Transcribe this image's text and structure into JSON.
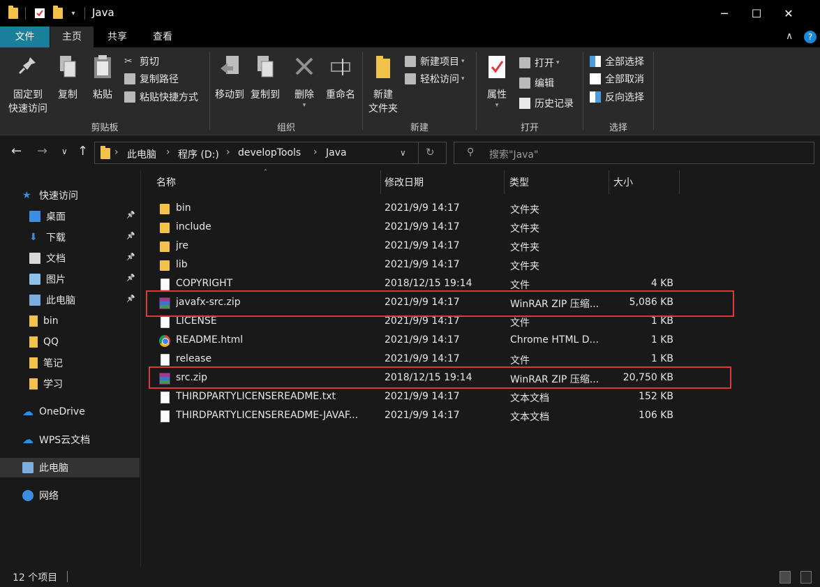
{
  "window": {
    "title": "Java",
    "controls": [
      "─",
      "☐",
      "✕"
    ]
  },
  "tabs": [
    "文件",
    "主页",
    "共享",
    "查看"
  ],
  "ribbon": {
    "clipboard": {
      "pin": "固定到\n快速访问",
      "pin_l1": "固定到",
      "pin_l2": "快速访问",
      "copy": "复制",
      "paste": "粘贴",
      "cut": "剪切",
      "copy_path": "复制路径",
      "paste_shortcut": "粘贴快捷方式",
      "label": "剪贴板"
    },
    "organize": {
      "move_to": "移动到",
      "copy_to": "复制到",
      "delete": "删除",
      "rename": "重命名",
      "label": "组织"
    },
    "new": {
      "new_folder_l1": "新建",
      "new_folder_l2": "文件夹",
      "new_item": "新建项目",
      "easy_access": "轻松访问",
      "label": "新建"
    },
    "open": {
      "properties": "属性",
      "open": "打开",
      "edit": "编辑",
      "history": "历史记录",
      "label": "打开"
    },
    "select": {
      "select_all": "全部选择",
      "select_none": "全部取消",
      "invert": "反向选择",
      "label": "选择"
    }
  },
  "address": {
    "crumbs": [
      "此电脑",
      "程序 (D:)",
      "developTools",
      "Java"
    ],
    "search_placeholder": "搜索\"Java\""
  },
  "sidebar": {
    "items": [
      {
        "label": "快速访问",
        "icon": "star-icon"
      },
      {
        "label": "桌面",
        "icon": "desktop-icon",
        "pinned": true
      },
      {
        "label": "下载",
        "icon": "download-icon",
        "pinned": true
      },
      {
        "label": "文档",
        "icon": "document-icon",
        "pinned": true
      },
      {
        "label": "图片",
        "icon": "picture-icon",
        "pinned": true
      },
      {
        "label": "此电脑",
        "icon": "computer-icon",
        "pinned": true
      },
      {
        "label": "bin",
        "icon": "folder-icon"
      },
      {
        "label": "QQ",
        "icon": "folder-icon"
      },
      {
        "label": "笔记",
        "icon": "folder-icon"
      },
      {
        "label": "学习",
        "icon": "folder-icon"
      },
      {
        "label": "OneDrive",
        "icon": "cloud-icon"
      },
      {
        "label": "WPS云文档",
        "icon": "cloud-outline-icon"
      },
      {
        "label": "此电脑",
        "icon": "computer-icon"
      },
      {
        "label": "网络",
        "icon": "network-icon"
      }
    ]
  },
  "columns": {
    "name": "名称",
    "date": "修改日期",
    "type": "类型",
    "size": "大小"
  },
  "files": [
    {
      "name": "bin",
      "date": "2021/9/9 14:17",
      "type": "文件夹",
      "size": "",
      "icon": "folder"
    },
    {
      "name": "include",
      "date": "2021/9/9 14:17",
      "type": "文件夹",
      "size": "",
      "icon": "folder"
    },
    {
      "name": "jre",
      "date": "2021/9/9 14:17",
      "type": "文件夹",
      "size": "",
      "icon": "folder"
    },
    {
      "name": "lib",
      "date": "2021/9/9 14:17",
      "type": "文件夹",
      "size": "",
      "icon": "folder"
    },
    {
      "name": "COPYRIGHT",
      "date": "2018/12/15 19:14",
      "type": "文件",
      "size": "4 KB",
      "icon": "file"
    },
    {
      "name": "javafx-src.zip",
      "date": "2021/9/9 14:17",
      "type": "WinRAR ZIP 压缩...",
      "size": "5,086 KB",
      "icon": "rar"
    },
    {
      "name": "LICENSE",
      "date": "2021/9/9 14:17",
      "type": "文件",
      "size": "1 KB",
      "icon": "file"
    },
    {
      "name": "README.html",
      "date": "2021/9/9 14:17",
      "type": "Chrome HTML D...",
      "size": "1 KB",
      "icon": "chrome"
    },
    {
      "name": "release",
      "date": "2021/9/9 14:17",
      "type": "文件",
      "size": "1 KB",
      "icon": "file"
    },
    {
      "name": "src.zip",
      "date": "2018/12/15 19:14",
      "type": "WinRAR ZIP 压缩...",
      "size": "20,750 KB",
      "icon": "rar"
    },
    {
      "name": "THIRDPARTYLICENSEREADME.txt",
      "date": "2021/9/9 14:17",
      "type": "文本文档",
      "size": "152 KB",
      "icon": "text"
    },
    {
      "name": "THIRDPARTYLICENSEREADME-JAVAF...",
      "date": "2021/9/9 14:17",
      "type": "文本文档",
      "size": "106 KB",
      "icon": "text"
    }
  ],
  "status": {
    "count": "12 个项目"
  },
  "colors": {
    "accent": "#1a7f9b",
    "highlight": "#e0383a",
    "folder": "#f3c24a"
  }
}
